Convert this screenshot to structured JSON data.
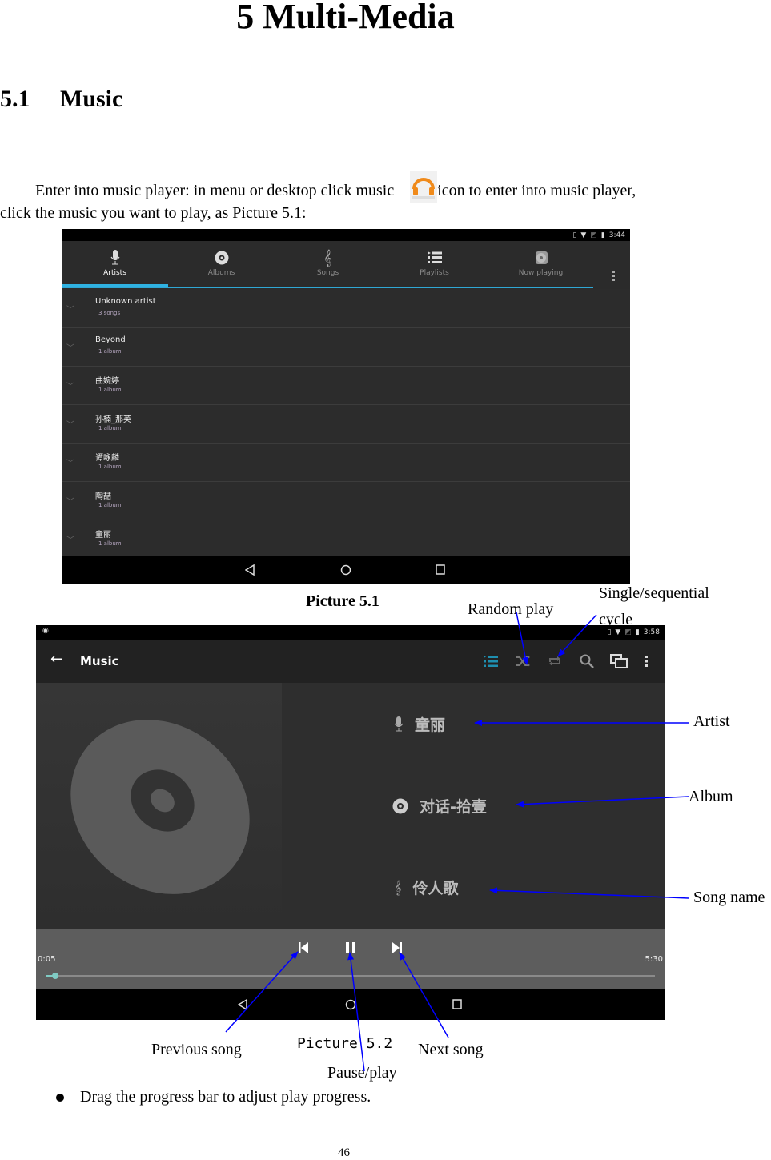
{
  "doc": {
    "chapter_title": "5 Multi-Media",
    "section_number": "5.1",
    "section_title": "Music",
    "intro_part1": "Enter into music player: in menu or desktop click music",
    "intro_part2": "icon to enter into music player,",
    "intro_line2": "click the music you want to play, as Picture 5.1:",
    "caption1": "Picture 5.1",
    "caption2": "Picture 5.2",
    "bullet_text": "Drag the progress bar to adjust play progress.",
    "page_number": "46",
    "app_icon_label": "Play Music"
  },
  "picture1": {
    "status_time": "3:44",
    "tabs": [
      {
        "label": "Artists",
        "icon": "microphone-icon",
        "active": true
      },
      {
        "label": "Albums",
        "icon": "disc-icon",
        "active": false
      },
      {
        "label": "Songs",
        "icon": "treble-clef-icon",
        "active": false
      },
      {
        "label": "Playlists",
        "icon": "playlist-icon",
        "active": false
      },
      {
        "label": "Now playing",
        "icon": "now-playing-icon",
        "active": false
      }
    ],
    "artists": [
      {
        "name": "Unknown artist",
        "sub": "3 songs"
      },
      {
        "name": "Beyond",
        "sub": "1 album"
      },
      {
        "name": "曲婉婷",
        "sub": "1 album"
      },
      {
        "name": "孙楠_那英",
        "sub": "1 album"
      },
      {
        "name": "谭咏麟",
        "sub": "1 album"
      },
      {
        "name": "陶喆",
        "sub": "1 album"
      },
      {
        "name": "童丽",
        "sub": "1 album"
      }
    ],
    "accent_color": "#2fb2e2"
  },
  "picture2": {
    "status_time": "3:58",
    "app_title": "Music",
    "artist": "童丽",
    "album": "对话-拾壹",
    "song": "伶人歌",
    "elapsed": "0:05",
    "duration": "5:30",
    "progress_fraction": 0.016,
    "accent_color": "#1e8fb0",
    "progress_color": "#80cbc4"
  },
  "annotations": {
    "random_play": "Random play",
    "single_sequential_1": "Single/sequential",
    "single_sequential_2": "cycle",
    "artist": "Artist",
    "album": "Album",
    "song_name": "Song name",
    "previous_song": "Previous song",
    "pause_play": "Pause/play",
    "next_song": "Next song",
    "arrow_color": "#0000ff"
  }
}
